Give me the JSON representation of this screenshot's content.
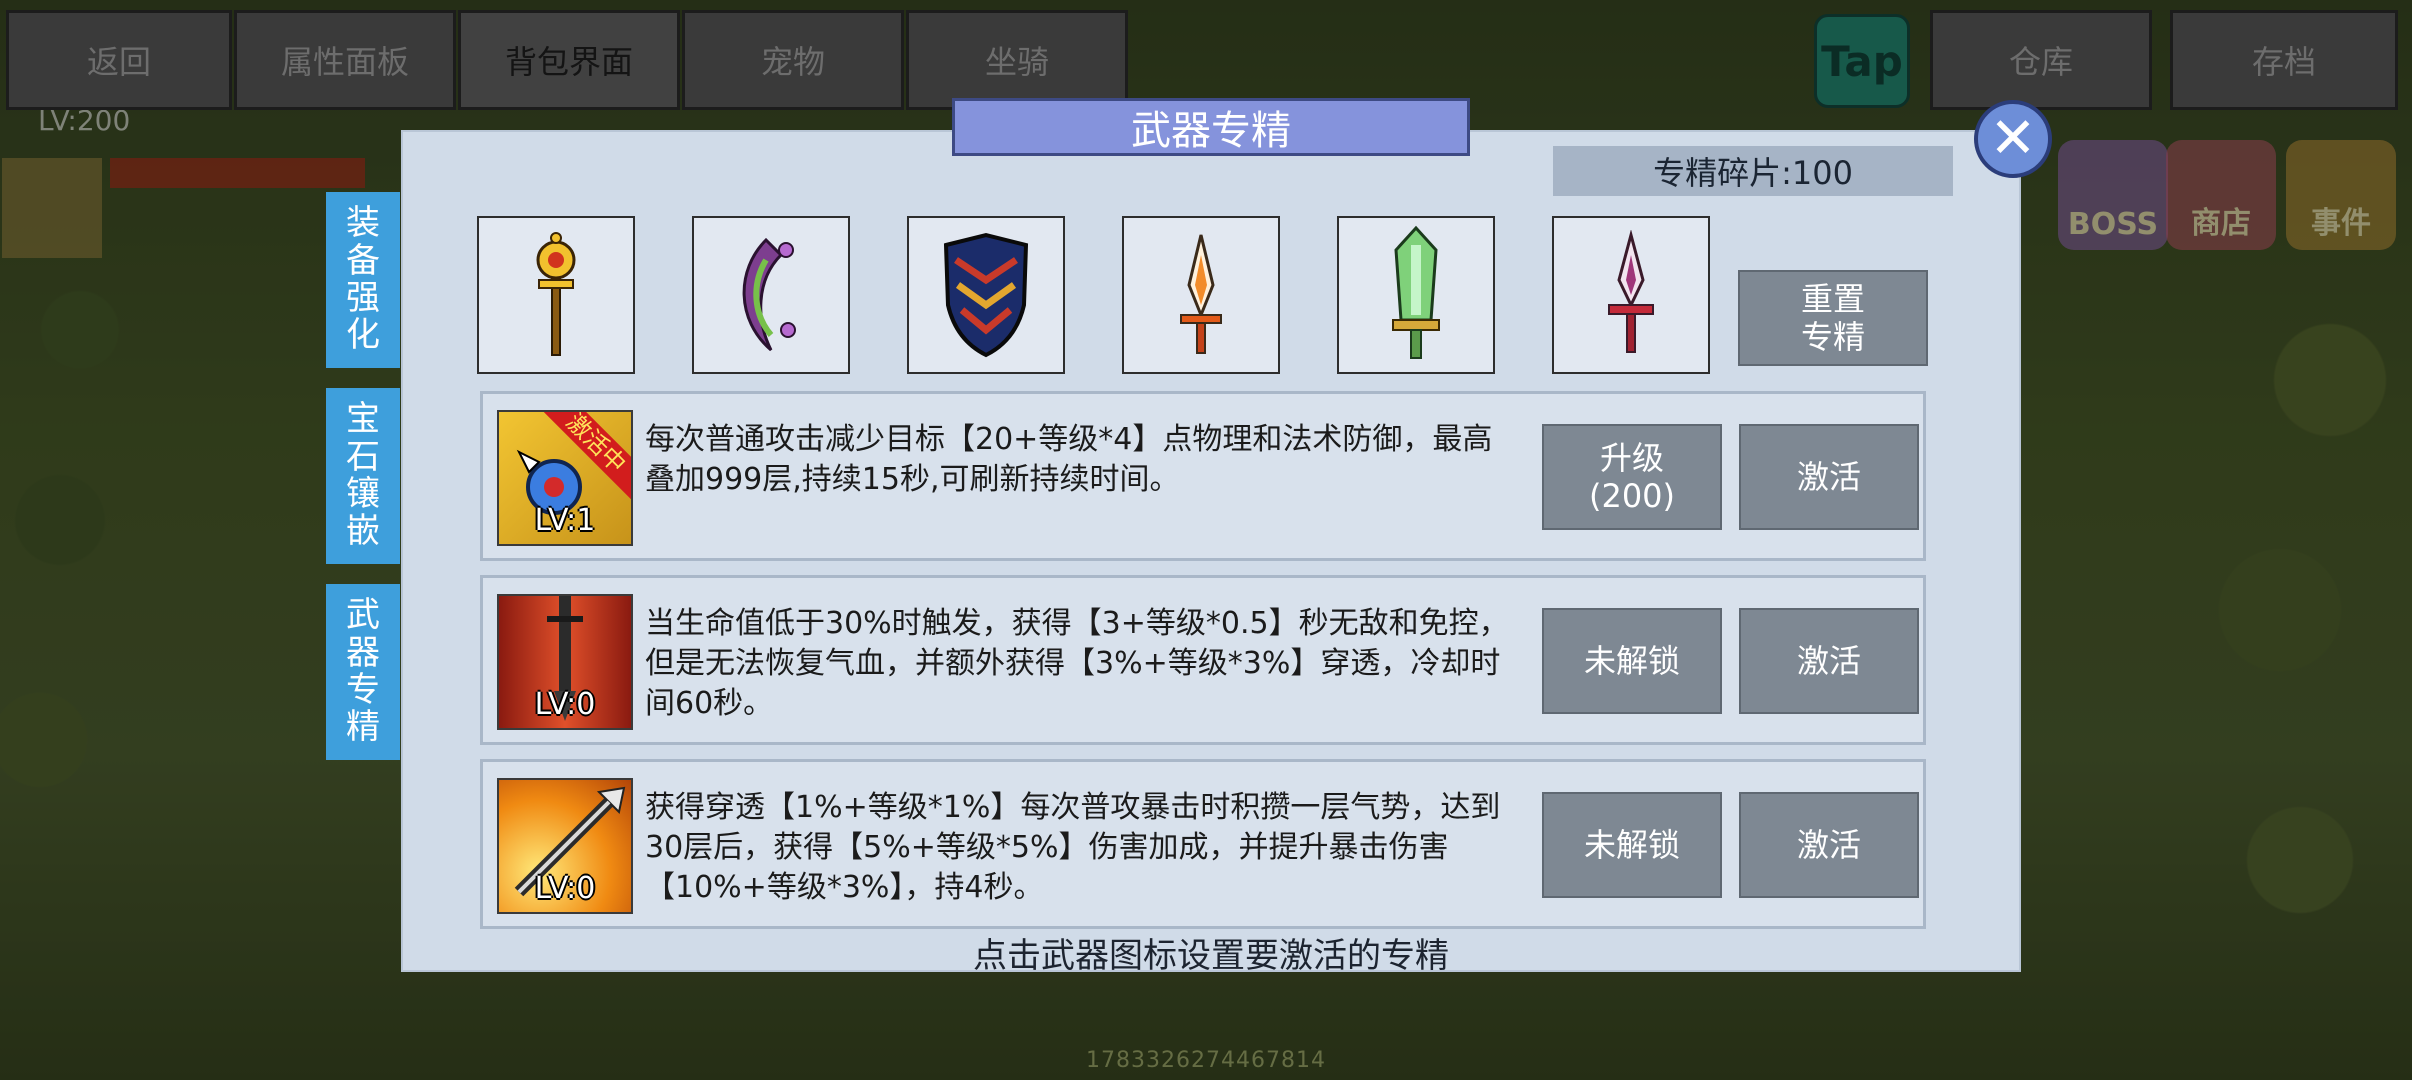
{
  "nav": {
    "tabs": [
      {
        "label": "返回"
      },
      {
        "label": "属性面板"
      },
      {
        "label": "背包界面"
      },
      {
        "label": "宠物"
      },
      {
        "label": "坐骑"
      }
    ],
    "tap_label": "Tap",
    "right_tabs": [
      {
        "label": "仓库"
      },
      {
        "label": "存档"
      }
    ]
  },
  "background": {
    "level_text": "LV:200",
    "footer_id": "1783326274467814",
    "right_icons": [
      "BOSS",
      "商店",
      "事件"
    ]
  },
  "modal": {
    "title": "武器专精",
    "close_symbol": "✕",
    "fragments_label": "专精碎片:100",
    "side_tabs": [
      {
        "label": [
          "装",
          "备",
          "强",
          "化"
        ]
      },
      {
        "label": [
          "宝",
          "石",
          "镶",
          "嵌"
        ]
      },
      {
        "label": [
          "武",
          "器",
          "专",
          "精"
        ]
      }
    ],
    "weapons": [
      "golden-scepter-icon",
      "crescent-blade-icon",
      "ornate-shield-icon",
      "flame-dagger-icon",
      "jade-sword-icon",
      "crimson-dagger-icon"
    ],
    "reset_label": [
      "重置",
      "专精"
    ],
    "skills": [
      {
        "level": "LV:1",
        "active_badge": "激活中",
        "description": "每次普通攻击减少目标【20+等级*4】点物理和法术防御，最高叠加999层,持续15秒,可刷新持续时间。",
        "upgrade_label": [
          "升级",
          "(200)"
        ],
        "activate_label": "激活"
      },
      {
        "level": "LV:0",
        "description": "当生命值低于30%时触发，获得【3+等级*0.5】秒无敌和免控，但是无法恢复气血，并额外获得【3%+等级*3%】穿透，冷却时间60秒。",
        "upgrade_label": [
          "未解锁"
        ],
        "activate_label": "激活"
      },
      {
        "level": "LV:0",
        "description": "获得穿透【1%+等级*1%】每次普攻暴击时积攒一层气势，达到30层后，获得【5%+等级*5%】伤害加成，并提升暴击伤害【10%+等级*3%】，持4秒。",
        "upgrade_label": [
          "未解锁"
        ],
        "activate_label": "激活"
      }
    ],
    "hint": "点击武器图标设置要激活的专精"
  },
  "colors": {
    "modal_bg": "#d0dbe8",
    "title_bg": "#8593dc",
    "side_tab_bg": "#3e9fdc",
    "button_bg": "#7e8893"
  }
}
